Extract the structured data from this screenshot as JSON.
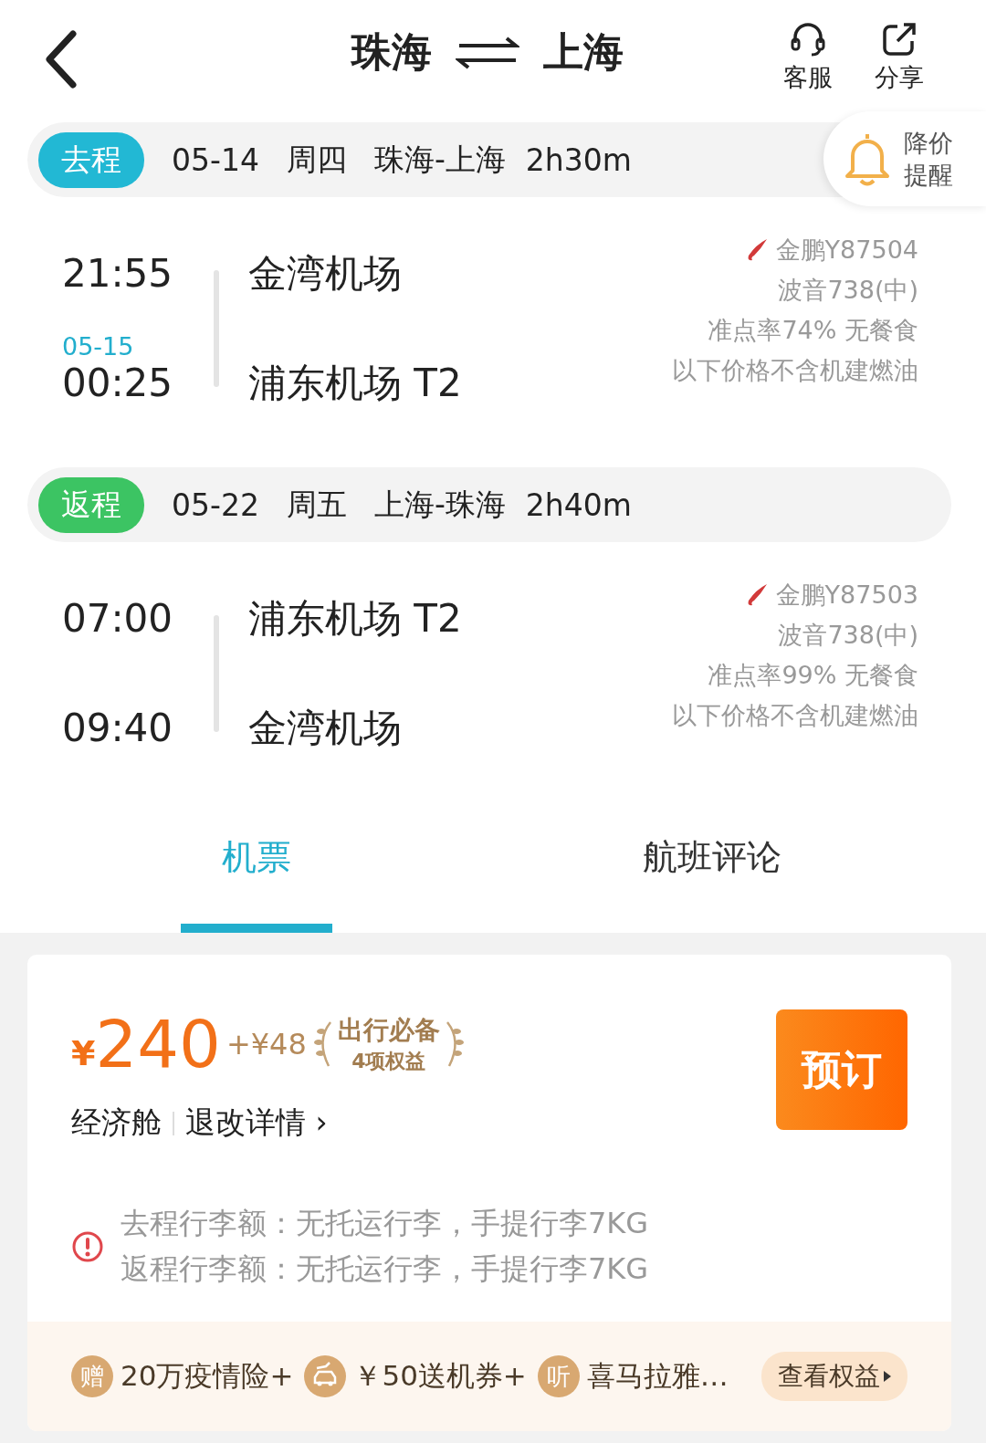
{
  "header": {
    "from": "珠海",
    "to": "上海",
    "actions": [
      {
        "kind": "service",
        "label": "客服"
      },
      {
        "kind": "share",
        "label": "分享"
      }
    ]
  },
  "price_alert": {
    "line1": "降价",
    "line2": "提醒"
  },
  "legs": [
    {
      "badge": "去程",
      "color": "#22b8d4",
      "date": "05-14",
      "weekday": "周四",
      "route": "珠海-上海",
      "duration": "2h30m",
      "depart_time": "21:55",
      "arrive_date": "05-15",
      "arrive_time": "00:25",
      "depart_airport": "金湾机场",
      "arrive_airport": "浦东机场 T2",
      "flight": "金鹏Y87504",
      "aircraft": "波音738(中)",
      "punctuality": "准点率74% 无餐食",
      "note": "以下价格不含机建燃油"
    },
    {
      "badge": "返程",
      "color": "#3cc463",
      "date": "05-22",
      "weekday": "周五",
      "route": "上海-珠海",
      "duration": "2h40m",
      "depart_time": "07:00",
      "arrive_time": "09:40",
      "depart_airport": "浦东机场 T2",
      "arrive_airport": "金湾机场",
      "flight": "金鹏Y87503",
      "aircraft": "波音738(中)",
      "punctuality": "准点率99% 无餐食",
      "note": "以下价格不含机建燃油"
    }
  ],
  "tabs": [
    {
      "label": "机票",
      "selected": true
    },
    {
      "label": "航班评论",
      "selected": false
    }
  ],
  "offer": {
    "currency": "¥",
    "price": "240",
    "extra": "+¥48",
    "badge_title": "出行必备",
    "badge_sub": "4项权益",
    "book": "预订",
    "cabin": "经济舱",
    "rules": "退改详情",
    "rules_arrow": "›",
    "baggage": [
      "去程行李额：无托运行李，手提行李7KG",
      "返程行李额：无托运行李，手提行李7KG"
    ],
    "perks": [
      {
        "kind": "char",
        "icon": "赠",
        "text": "20万疫情险+"
      },
      {
        "kind": "car",
        "text": "￥50送机券+"
      },
      {
        "kind": "char",
        "icon": "听",
        "text": "喜马拉雅…"
      }
    ],
    "perks_button": "查看权益"
  }
}
